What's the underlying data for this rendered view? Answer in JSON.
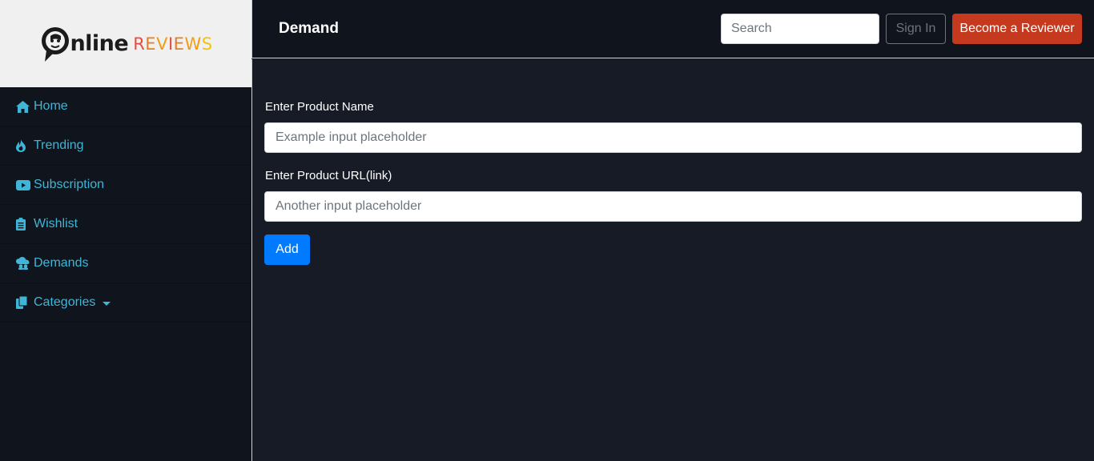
{
  "brand": {
    "logo_o": "O",
    "logo_nline": "nline",
    "logo_reviews_letters": [
      {
        "ch": "R",
        "color": "#e74c3c"
      },
      {
        "ch": "E",
        "color": "#e67e22"
      },
      {
        "ch": "V",
        "color": "#f39c12"
      },
      {
        "ch": "I",
        "color": "#e74c3c"
      },
      {
        "ch": "E",
        "color": "#e67e22"
      },
      {
        "ch": "W",
        "color": "#f39c12"
      },
      {
        "ch": "S",
        "color": "#f1c40f"
      }
    ]
  },
  "sidebar": {
    "items": [
      {
        "label": "Home",
        "icon": "home-icon"
      },
      {
        "label": "Trending",
        "icon": "fire-icon"
      },
      {
        "label": "Subscription",
        "icon": "youtube-icon"
      },
      {
        "label": "Wishlist",
        "icon": "clipboard-icon"
      },
      {
        "label": "Demands",
        "icon": "cloud-users-icon"
      },
      {
        "label": "Categories",
        "icon": "copy-icon"
      }
    ]
  },
  "header": {
    "title": "Demand",
    "search_placeholder": "Search",
    "sign_in_label": "Sign In",
    "become_reviewer_label": "Become a Reviewer"
  },
  "form": {
    "product_name_label": "Enter Product Name",
    "product_name_placeholder": "Example input placeholder",
    "product_url_label": "Enter Product URL(link)",
    "product_url_placeholder": "Another input placeholder",
    "add_label": "Add"
  },
  "colors": {
    "accent_link": "#3fb6d8",
    "primary_button": "#007bff",
    "reviewer_button": "#c53a1f",
    "background": "#161b26",
    "sidebar_background": "#10141c"
  }
}
